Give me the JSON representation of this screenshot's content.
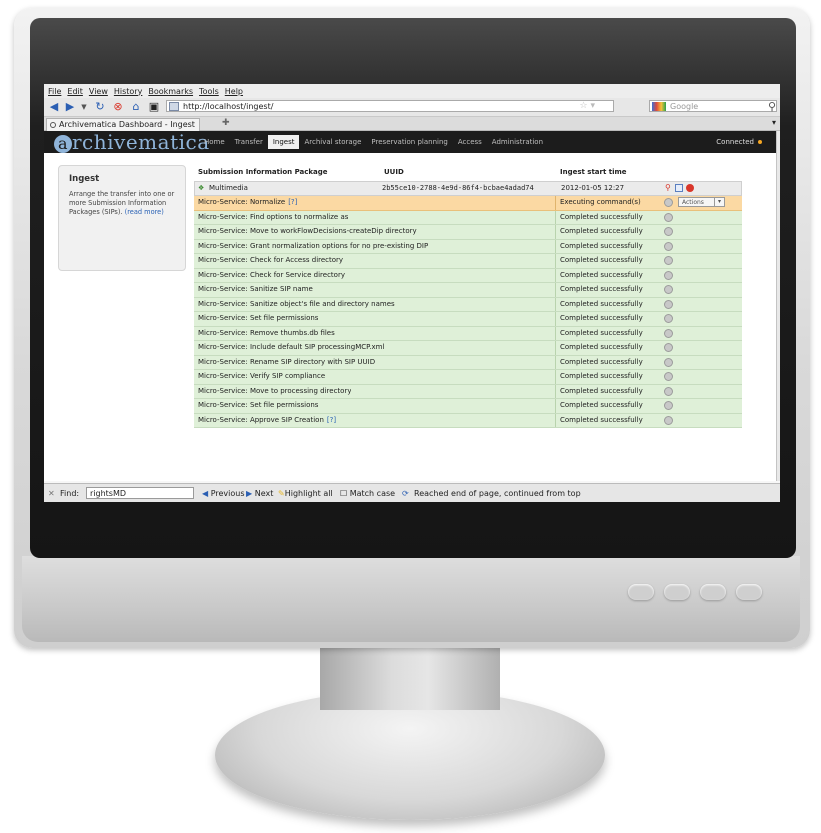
{
  "browser": {
    "menu": [
      "File",
      "Edit",
      "View",
      "History",
      "Bookmarks",
      "Tools",
      "Help"
    ],
    "url": "http://localhost/ingest/",
    "search_placeholder": "Google",
    "tab_title": "Archivematica Dashboard - Ingest"
  },
  "app": {
    "logo_letter": "a",
    "logo_text": "rchivematica",
    "nav": [
      "Home",
      "Transfer",
      "Ingest",
      "Archival storage",
      "Preservation planning",
      "Access",
      "Administration"
    ],
    "active_nav": "Ingest",
    "status": "Connected"
  },
  "sidebar": {
    "title": "Ingest",
    "text": "Arrange the transfer into one or more Submission Information Packages (SIPs).",
    "link": "(read more)"
  },
  "table": {
    "headers": [
      "Submission Information Package",
      "UUID",
      "Ingest start time"
    ],
    "sip": {
      "name": "Multimedia",
      "uuid": "2b55ce10-2788-4e9d-86f4-bcbae4adad74",
      "start": "2012-01-05 12:27"
    },
    "actions_label": "Actions",
    "microservices": [
      {
        "name": "Micro-Service: Normalize",
        "help": "[?]",
        "status": "Executing command(s)",
        "running": true
      },
      {
        "name": "Micro-Service: Find options to normalize as",
        "help": "",
        "status": "Completed successfully",
        "running": false
      },
      {
        "name": "Micro-Service: Move to workFlowDecisions-createDip directory",
        "help": "",
        "status": "Completed successfully",
        "running": false
      },
      {
        "name": "Micro-Service: Grant normalization options for no pre-existing DIP",
        "help": "",
        "status": "Completed successfully",
        "running": false
      },
      {
        "name": "Micro-Service: Check for Access directory",
        "help": "",
        "status": "Completed successfully",
        "running": false
      },
      {
        "name": "Micro-Service: Check for Service directory",
        "help": "",
        "status": "Completed successfully",
        "running": false
      },
      {
        "name": "Micro-Service: Sanitize SIP name",
        "help": "",
        "status": "Completed successfully",
        "running": false
      },
      {
        "name": "Micro-Service: Sanitize object's file and directory names",
        "help": "",
        "status": "Completed successfully",
        "running": false
      },
      {
        "name": "Micro-Service: Set file permissions",
        "help": "",
        "status": "Completed successfully",
        "running": false
      },
      {
        "name": "Micro-Service: Remove thumbs.db files",
        "help": "",
        "status": "Completed successfully",
        "running": false
      },
      {
        "name": "Micro-Service: Include default SIP processingMCP.xml",
        "help": "",
        "status": "Completed successfully",
        "running": false
      },
      {
        "name": "Micro-Service: Rename SIP directory with SIP UUID",
        "help": "",
        "status": "Completed successfully",
        "running": false
      },
      {
        "name": "Micro-Service: Verify SIP compliance",
        "help": "",
        "status": "Completed successfully",
        "running": false
      },
      {
        "name": "Micro-Service: Move to processing directory",
        "help": "",
        "status": "Completed successfully",
        "running": false
      },
      {
        "name": "Micro-Service: Set file permissions",
        "help": "",
        "status": "Completed successfully",
        "running": false
      },
      {
        "name": "Micro-Service: Approve SIP Creation",
        "help": "[?]",
        "status": "Completed successfully",
        "running": false
      }
    ]
  },
  "findbar": {
    "label": "Find:",
    "value": "rightsMD",
    "previous": "Previous",
    "next": "Next",
    "highlight": "Highlight all",
    "match_case": "Match case",
    "message": "Reached end of page, continued from top"
  }
}
